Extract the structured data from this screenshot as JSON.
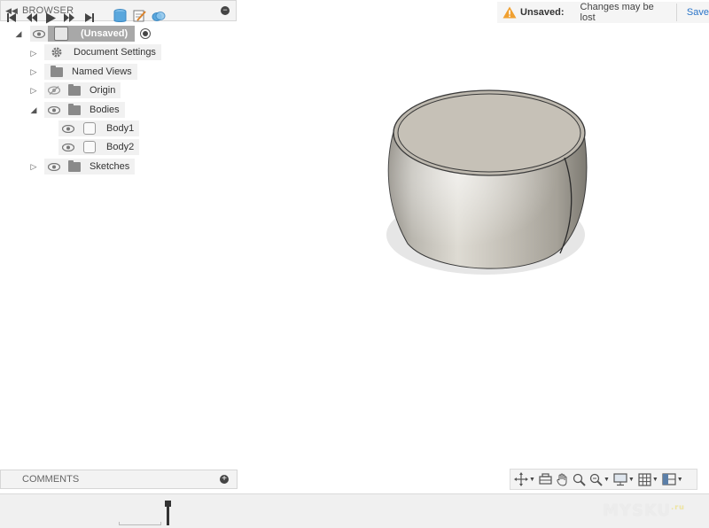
{
  "browser": {
    "title": "BROWSER",
    "root_label": "(Unsaved)",
    "items": [
      {
        "label": "Document Settings"
      },
      {
        "label": "Named Views"
      },
      {
        "label": "Origin"
      },
      {
        "label": "Bodies"
      },
      {
        "label": "Body1"
      },
      {
        "label": "Body2"
      },
      {
        "label": "Sketches"
      }
    ]
  },
  "status": {
    "unsaved_label": "Unsaved:",
    "message": "Changes may be lost",
    "save": "Save",
    "warning_color": "#f0a030"
  },
  "comments": {
    "title": "COMMENTS"
  },
  "watermark": {
    "text": "MYSKU",
    "suffix": ".ru"
  },
  "colors": {
    "accent": "#2a74c8",
    "panel": "#f3f3f3"
  },
  "nav_icons": [
    "orbit-icon",
    "look-at-icon",
    "pan-icon",
    "zoom-icon",
    "fit-icon",
    "display-mode-icon",
    "grid-icon",
    "viewports-icon"
  ],
  "timeline_icons": [
    "first-icon",
    "previous-icon",
    "play-icon",
    "next-icon",
    "last-icon",
    "body-feature-icon",
    "sketch-feature-icon",
    "combine-feature-icon"
  ]
}
